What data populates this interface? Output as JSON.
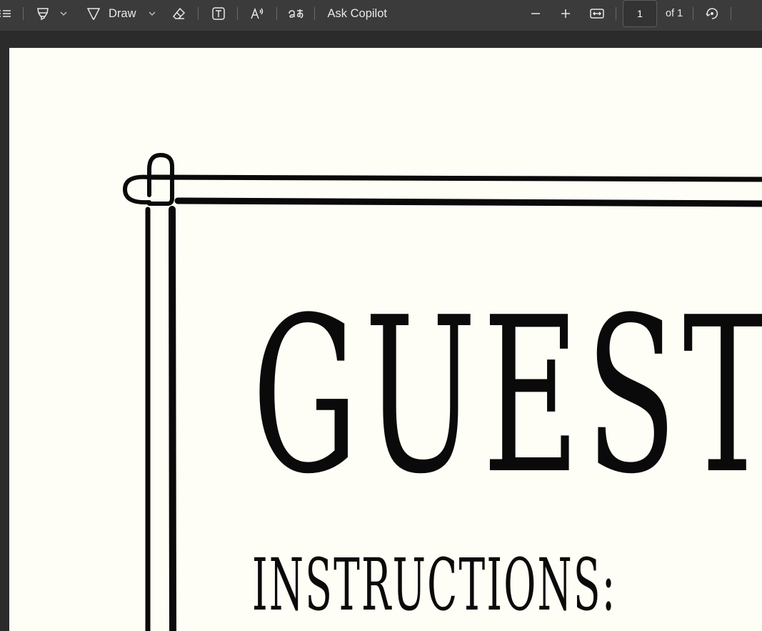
{
  "toolbar": {
    "icons": {
      "contents": "contents-menu-icon",
      "highlight": "highlighter-icon",
      "draw": "draw-pen-icon",
      "erase": "eraser-icon",
      "text": "text-box-icon",
      "read_aloud": "read-aloud-icon",
      "translate": "translate-icon",
      "zoom_out": "minus-icon",
      "zoom_in": "plus-icon",
      "fit": "fit-width-icon",
      "rotate": "rotate-icon"
    },
    "draw_label": "Draw",
    "ask_copilot_label": "Ask Copilot",
    "page_number": "1",
    "page_total_label": "of 1"
  },
  "document": {
    "title": "GUEST",
    "subtitle": "INSTRUCTIONS:"
  },
  "colors": {
    "toolbar_bg": "#3b3b3b",
    "viewer_bg": "#2b2b2b",
    "page_bg": "#fefef6",
    "ink": "#0a0a0a"
  }
}
